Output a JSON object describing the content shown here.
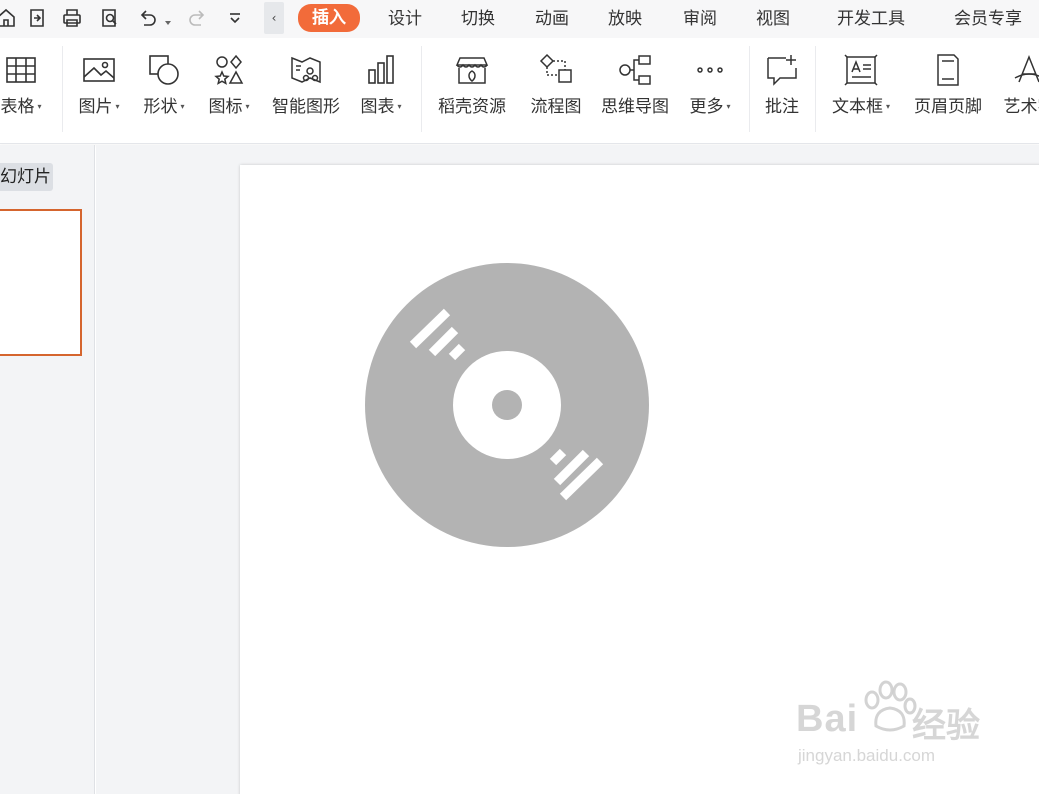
{
  "menu": {
    "tabs": [
      {
        "label": "插入",
        "active": true
      },
      {
        "label": "设计"
      },
      {
        "label": "切换"
      },
      {
        "label": "动画"
      },
      {
        "label": "放映"
      },
      {
        "label": "审阅"
      },
      {
        "label": "视图"
      },
      {
        "label": "开发工具"
      },
      {
        "label": "会员专享"
      }
    ],
    "collapse_glyph": "‹",
    "active_color": "#f26b3a"
  },
  "ribbon": {
    "table": "表格",
    "picture": "图片",
    "shape": "形状",
    "icon": "图标",
    "smart_graphic": "智能图形",
    "chart": "图表",
    "docer_resources": "稻壳资源",
    "flowchart": "流程图",
    "mindmap": "思维导图",
    "more": "更多",
    "comment": "批注",
    "textbox": "文本框",
    "header_footer": "页眉页脚",
    "wordart": "艺术字",
    "dropdown_glyph": "▾"
  },
  "leftpanel": {
    "slides_tab": "幻灯片",
    "thumb_border_color": "#d5652e"
  },
  "slide": {
    "disc_color": "#b3b3b3"
  },
  "watermark": {
    "brand": "Bai",
    "brand_suffix": "经验",
    "url": "jingyan.baidu.com"
  }
}
